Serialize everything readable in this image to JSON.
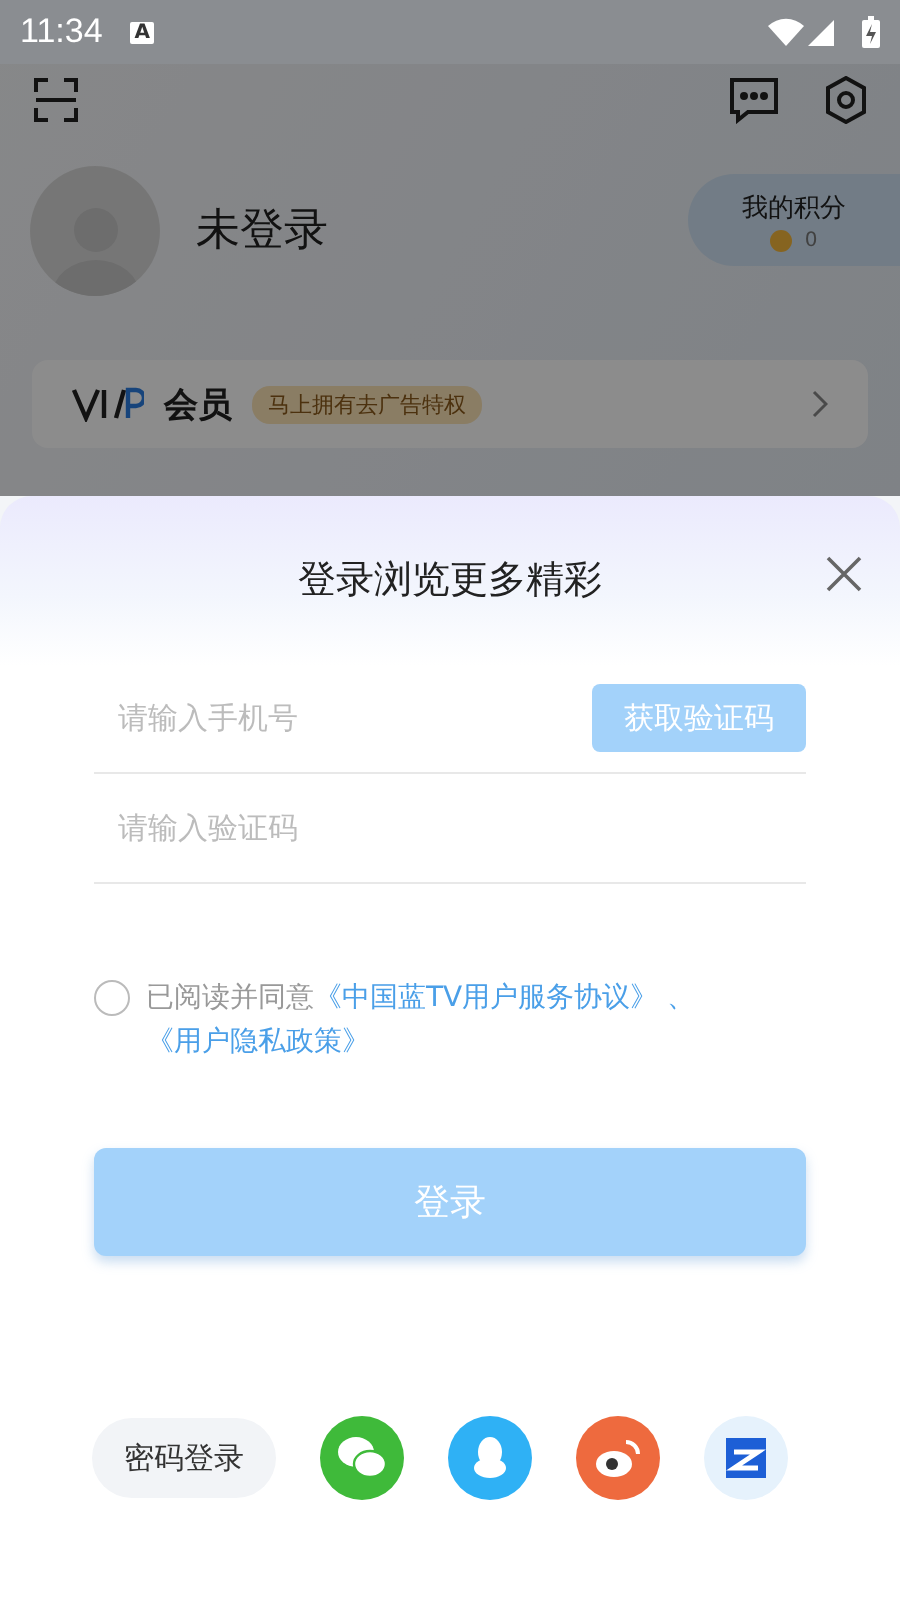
{
  "status_bar": {
    "time": "11:34",
    "notification": "A"
  },
  "profile": {
    "name": "未登录",
    "points_label": "我的积分",
    "points_value": "0"
  },
  "vip": {
    "label": "会员",
    "promo": "马上拥有去广告特权"
  },
  "login_sheet": {
    "title": "登录浏览更多精彩",
    "phone_field": {
      "placeholder": "请输入手机号"
    },
    "code_button": "获取验证码",
    "code_field": {
      "placeholder": "请输入验证码"
    },
    "agreement": {
      "checked": false,
      "text": "已阅读并同意",
      "links": [
        "《中国蓝TV用户服务协议》",
        "《用户隐私政策》"
      ],
      "separator": "、"
    },
    "login_button": {
      "label": "登录",
      "disabled": true
    },
    "password_login": "密码登录",
    "social": [
      {
        "kind": "wechat"
      },
      {
        "kind": "qq"
      },
      {
        "kind": "weibo"
      },
      {
        "kind": "zhejiang"
      }
    ]
  }
}
